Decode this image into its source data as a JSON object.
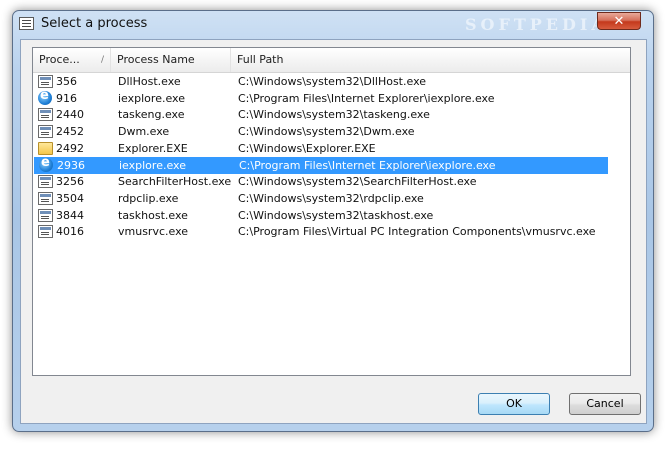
{
  "window": {
    "title": "Select a process",
    "watermark": "SOFTPEDIA",
    "close_label": "✕"
  },
  "listview": {
    "columns": [
      {
        "label": "Proce...",
        "sort_indicator": "/"
      },
      {
        "label": "Process Name"
      },
      {
        "label": "Full Path"
      }
    ],
    "rows": [
      {
        "pid": "356",
        "name": "DllHost.exe",
        "path": "C:\\Windows\\system32\\DllHost.exe",
        "icon": "generic-exe-icon",
        "selected": false
      },
      {
        "pid": "916",
        "name": "iexplore.exe",
        "path": "C:\\Program Files\\Internet Explorer\\iexplore.exe",
        "icon": "internet-explorer-icon",
        "selected": false
      },
      {
        "pid": "2440",
        "name": "taskeng.exe",
        "path": "C:\\Windows\\system32\\taskeng.exe",
        "icon": "generic-exe-icon",
        "selected": false
      },
      {
        "pid": "2452",
        "name": "Dwm.exe",
        "path": "C:\\Windows\\system32\\Dwm.exe",
        "icon": "generic-exe-icon",
        "selected": false
      },
      {
        "pid": "2492",
        "name": "Explorer.EXE",
        "path": "C:\\Windows\\Explorer.EXE",
        "icon": "folder-icon",
        "selected": false
      },
      {
        "pid": "2936",
        "name": "iexplore.exe",
        "path": "C:\\Program Files\\Internet Explorer\\iexplore.exe",
        "icon": "internet-explorer-icon",
        "selected": true
      },
      {
        "pid": "3256",
        "name": "SearchFilterHost.exe",
        "path": "C:\\Windows\\system32\\SearchFilterHost.exe",
        "icon": "generic-exe-icon",
        "selected": false
      },
      {
        "pid": "3504",
        "name": "rdpclip.exe",
        "path": "C:\\Windows\\system32\\rdpclip.exe",
        "icon": "generic-exe-icon",
        "selected": false
      },
      {
        "pid": "3844",
        "name": "taskhost.exe",
        "path": "C:\\Windows\\system32\\taskhost.exe",
        "icon": "generic-exe-icon",
        "selected": false
      },
      {
        "pid": "4016",
        "name": "vmusrvc.exe",
        "path": "C:\\Program Files\\Virtual PC Integration Components\\vmusrvc.exe",
        "icon": "generic-exe-icon",
        "selected": false
      }
    ]
  },
  "buttons": {
    "ok_label": "OK",
    "cancel_label": "Cancel"
  },
  "colors": {
    "selection": "#3399ff"
  }
}
